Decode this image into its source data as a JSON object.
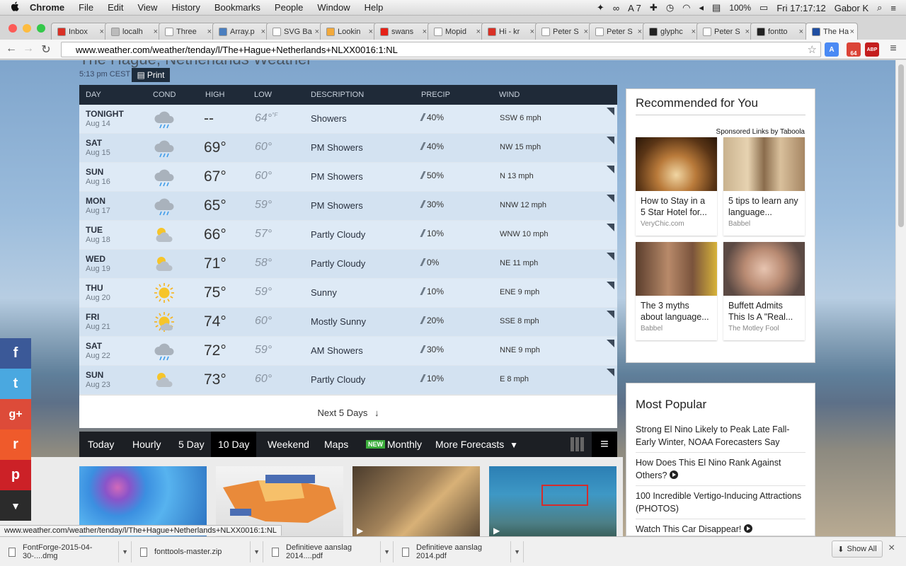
{
  "menubar": {
    "apple": "",
    "app_name": "Chrome",
    "menus": [
      "File",
      "Edit",
      "View",
      "History",
      "Bookmarks",
      "People",
      "Window",
      "Help"
    ],
    "battery": "100%",
    "clock": "Fri 17:17:12",
    "user": "Gabor K",
    "status_a7": "A 7"
  },
  "tabs": [
    {
      "label": "Inbox",
      "color": "#d93025"
    },
    {
      "label": "localh",
      "color": "#bbbbbb"
    },
    {
      "label": "Three",
      "color": "#ffffff"
    },
    {
      "label": "Array.p",
      "color": "#4a7ebf"
    },
    {
      "label": "SVG Ba",
      "color": "#ffffff"
    },
    {
      "label": "Lookin",
      "color": "#f2a93b"
    },
    {
      "label": "swans",
      "color": "#e62117"
    },
    {
      "label": "Mopid",
      "color": "#ffffff"
    },
    {
      "label": "Hi - kr",
      "color": "#d93025"
    },
    {
      "label": "Peter S",
      "color": "#ffffff"
    },
    {
      "label": "Peter S",
      "color": "#ffffff"
    },
    {
      "label": "glyphc",
      "color": "#222222"
    },
    {
      "label": "Peter S",
      "color": "#ffffff"
    },
    {
      "label": "fontto",
      "color": "#222222"
    },
    {
      "label": "The Ha",
      "color": "#1f4ea1"
    }
  ],
  "tab_close": "×",
  "url": "www.weather.com/weather/tenday/l/The+Hague+Netherlands+NLXX0016:1:NL",
  "ext": {
    "mail_count": "64",
    "abp_count": "6",
    "abp": "ABP"
  },
  "page": {
    "title_fragment": "The Hague, Netherlands Weather",
    "updated": "5:13 pm CEST",
    "print_label": "Print",
    "headers": {
      "day": "DAY",
      "cond": "COND",
      "high": "HIGH",
      "low": "LOW",
      "description": "DESCRIPTION",
      "precip": "PRECIP",
      "wind": "WIND"
    },
    "rows": [
      {
        "day": "TONIGHT",
        "date": "Aug 14",
        "icon": "rain-cloud",
        "high": "--",
        "low": "64°",
        "low_unit": "°F",
        "desc": "Showers",
        "precip": "40%",
        "wind": "SSW 6 mph"
      },
      {
        "day": "SAT",
        "date": "Aug 15",
        "icon": "rain-cloud",
        "high": "69°",
        "low": "60°",
        "desc": "PM Showers",
        "precip": "40%",
        "wind": "NW 15 mph"
      },
      {
        "day": "SUN",
        "date": "Aug 16",
        "icon": "rain-cloud",
        "high": "67°",
        "low": "60°",
        "desc": "PM Showers",
        "precip": "50%",
        "wind": "N 13 mph"
      },
      {
        "day": "MON",
        "date": "Aug 17",
        "icon": "rain-cloud",
        "high": "65°",
        "low": "59°",
        "desc": "PM Showers",
        "precip": "30%",
        "wind": "NNW 12 mph"
      },
      {
        "day": "TUE",
        "date": "Aug 18",
        "icon": "partly-cloudy",
        "high": "66°",
        "low": "57°",
        "desc": "Partly Cloudy",
        "precip": "10%",
        "wind": "WNW 10 mph"
      },
      {
        "day": "WED",
        "date": "Aug 19",
        "icon": "partly-cloudy",
        "high": "71°",
        "low": "58°",
        "desc": "Partly Cloudy",
        "precip": "0%",
        "wind": "NE 11 mph"
      },
      {
        "day": "THU",
        "date": "Aug 20",
        "icon": "sunny",
        "high": "75°",
        "low": "59°",
        "desc": "Sunny",
        "precip": "10%",
        "wind": "ENE 9 mph"
      },
      {
        "day": "FRI",
        "date": "Aug 21",
        "icon": "mostly-sunny",
        "high": "74°",
        "low": "60°",
        "desc": "Mostly Sunny",
        "precip": "20%",
        "wind": "SSE 8 mph"
      },
      {
        "day": "SAT",
        "date": "Aug 22",
        "icon": "rain-cloud",
        "high": "72°",
        "low": "59°",
        "desc": "AM Showers",
        "precip": "30%",
        "wind": "NNE 9 mph"
      },
      {
        "day": "SUN",
        "date": "Aug 23",
        "icon": "partly-cloudy",
        "high": "73°",
        "low": "60°",
        "desc": "Partly Cloudy",
        "precip": "10%",
        "wind": "E 8 mph"
      }
    ],
    "next_label": "Next 5 Days",
    "next_arrow": "↓",
    "forecast_nav": [
      {
        "label": "Today"
      },
      {
        "label": "Hourly"
      },
      {
        "label": "5 Day"
      },
      {
        "label": "10 Day",
        "active": true
      },
      {
        "label": "Weekend"
      },
      {
        "label": "Maps"
      },
      {
        "label": "Monthly",
        "badge": "NEW"
      },
      {
        "label": "More Forecasts"
      }
    ],
    "more_arrow": "▼"
  },
  "recommended": {
    "title": "Recommended for You",
    "sponsor": "Sponsored Links by Taboola",
    "cards": [
      {
        "caption": "How to Stay in a 5 Star Hotel for...",
        "source": "VeryChic.com"
      },
      {
        "caption": "5 tips to learn any language...",
        "source": "Babbel"
      },
      {
        "caption": "The 3 myths about language...",
        "source": "Babbel"
      },
      {
        "caption": "Buffett Admits This Is A \"Real...",
        "source": "The Motley Fool"
      }
    ]
  },
  "popular": {
    "title": "Most Popular",
    "items": [
      {
        "text": "Strong El Nino Likely to Peak Late Fall-Early Winter, NOAA Forecasters Say",
        "video": false
      },
      {
        "text": "How Does This El Nino Rank Against Others?",
        "video": true
      },
      {
        "text": "100 Incredible Vertigo-Inducing Attractions (PHOTOS)",
        "video": false
      },
      {
        "text": "Watch This Car Disappear!",
        "video": true
      }
    ]
  },
  "share": {
    "facebook": "f",
    "twitter": "t",
    "gplus": "g+",
    "reddit": "r",
    "pinterest": "p",
    "more": "▼"
  },
  "status_url": "www.weather.com/weather/tenday/l/The+Hague+Netherlands+NLXX0016:1:NL",
  "downloads": [
    {
      "name": "FontForge-2015-04-30-....dmg"
    },
    {
      "name": "fonttools-master.zip"
    },
    {
      "name": "Definitieve aanslag 2014....pdf"
    },
    {
      "name": "Definitieve aanslag 2014.pdf"
    }
  ],
  "show_all": "Show All",
  "close": "×"
}
